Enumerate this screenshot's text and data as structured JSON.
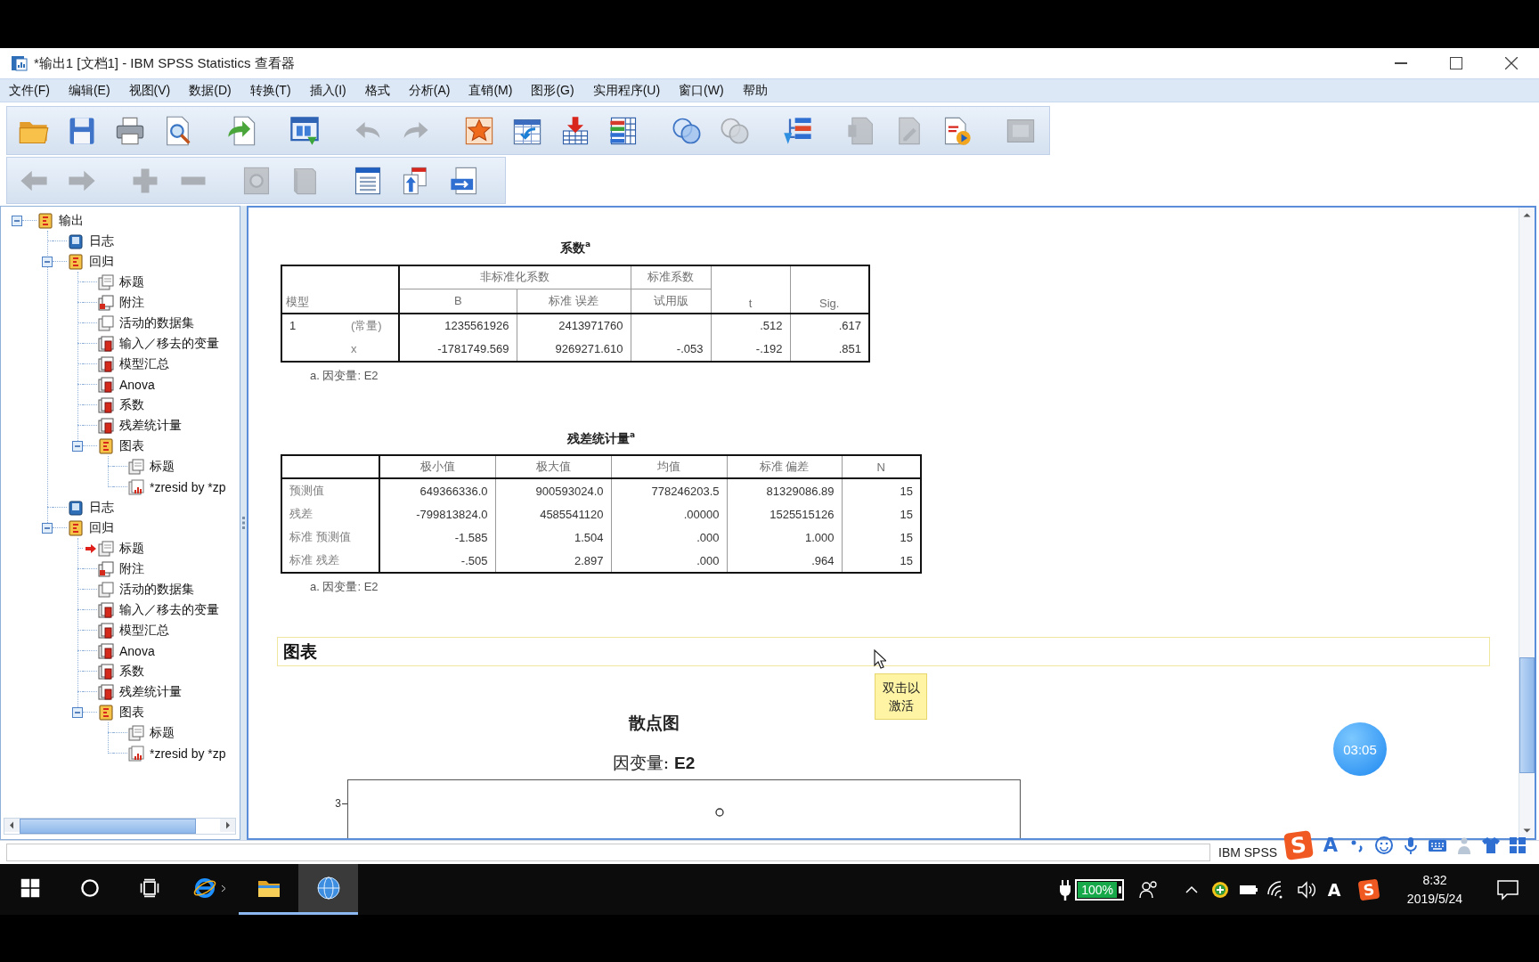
{
  "window": {
    "title": "*输出1 [文档1] - IBM SPSS Statistics 查看器"
  },
  "menu": [
    "文件(F)",
    "编辑(E)",
    "视图(V)",
    "数据(D)",
    "转换(T)",
    "插入(I)",
    "格式",
    "分析(A)",
    "直销(M)",
    "图形(G)",
    "实用程序(U)",
    "窗口(W)",
    "帮助"
  ],
  "toolbars": [
    {
      "groups": [
        [
          {
            "disabled": false
          },
          {
            "disabled": false
          },
          {
            "disabled": false
          },
          {
            "disabled": false
          }
        ],
        [
          {
            "disabled": false
          }
        ],
        [
          {
            "disabled": false
          }
        ],
        [
          {
            "disabled": true
          },
          {
            "disabled": true
          }
        ],
        [
          {
            "disabled": false
          },
          {
            "disabled": false
          },
          {
            "disabled": false
          },
          {
            "disabled": false
          }
        ],
        [
          {
            "disabled": false
          },
          {
            "disabled": true
          }
        ],
        [
          {
            "disabled": false
          }
        ],
        [
          {
            "disabled": true
          },
          {
            "disabled": true
          },
          {
            "disabled": false
          }
        ],
        [
          {
            "disabled": true
          }
        ]
      ]
    },
    {
      "groups": [
        [
          {
            "disabled": true
          },
          {
            "disabled": true
          }
        ],
        [
          {
            "disabled": true
          },
          {
            "disabled": true
          }
        ],
        [
          {
            "disabled": true
          },
          {
            "disabled": true
          }
        ],
        [
          {
            "disabled": false
          },
          {
            "disabled": false
          },
          {
            "disabled": false
          }
        ]
      ]
    }
  ],
  "outline": {
    "items": [
      {
        "label": "输出",
        "kind": "heading",
        "expanded": true,
        "selected": false,
        "children": [
          {
            "label": "日志",
            "kind": "log",
            "selected": false
          },
          {
            "label": "回归",
            "kind": "heading",
            "expanded": true,
            "selected": false,
            "children": [
              {
                "label": "标题",
                "kind": "title",
                "selected": false
              },
              {
                "label": "附注",
                "kind": "notes",
                "selected": false
              },
              {
                "label": "活动的数据集",
                "kind": "text",
                "selected": false
              },
              {
                "label": "输入／移去的变量",
                "kind": "table",
                "selected": false
              },
              {
                "label": "模型汇总",
                "kind": "table",
                "selected": false
              },
              {
                "label": "Anova",
                "kind": "table",
                "selected": false
              },
              {
                "label": "系数",
                "kind": "table",
                "selected": false
              },
              {
                "label": "残差统计量",
                "kind": "table",
                "selected": false
              },
              {
                "label": "图表",
                "kind": "heading",
                "expanded": true,
                "selected": false,
                "children": [
                  {
                    "label": "标题",
                    "kind": "title",
                    "selected": false
                  },
                  {
                    "label": "*zresid by *zp",
                    "kind": "chart",
                    "selected": false
                  }
                ]
              }
            ]
          },
          {
            "label": "日志",
            "kind": "log",
            "selected": false
          },
          {
            "label": "回归",
            "kind": "heading",
            "expanded": true,
            "selected": false,
            "children": [
              {
                "label": "标题",
                "kind": "title",
                "selected": true
              },
              {
                "label": "附注",
                "kind": "notes",
                "selected": false
              },
              {
                "label": "活动的数据集",
                "kind": "text",
                "selected": false
              },
              {
                "label": "输入／移去的变量",
                "kind": "table",
                "selected": false
              },
              {
                "label": "模型汇总",
                "kind": "table",
                "selected": false
              },
              {
                "label": "Anova",
                "kind": "table",
                "selected": false
              },
              {
                "label": "系数",
                "kind": "table",
                "selected": false
              },
              {
                "label": "残差统计量",
                "kind": "table",
                "selected": false
              },
              {
                "label": "图表",
                "kind": "heading",
                "expanded": true,
                "selected": false,
                "children": [
                  {
                    "label": "标题",
                    "kind": "title",
                    "selected": false
                  },
                  {
                    "label": "*zresid by *zp",
                    "kind": "chart",
                    "selected": false
                  }
                ]
              }
            ]
          }
        ]
      }
    ]
  },
  "output": {
    "tables": [
      {
        "kind": "coefficients",
        "title": "系数$^{a}$",
        "header_rows": [
          [
            {
              "text": "模型",
              "colspan": 2,
              "rowspan": 2
            },
            {
              "text": "非标准化系数",
              "colspan": 2
            },
            {
              "text": "标准系数"
            },
            {
              "text": "t",
              "rowspan": 2
            },
            {
              "text": "Sig.",
              "rowspan": 2
            }
          ],
          [
            {
              "text": "B"
            },
            {
              "text": "标准 误差"
            },
            {
              "text": "试用版"
            }
          ]
        ],
        "rows": [
          [
            "1",
            "(常量)",
            "1235561926",
            "2413971760",
            null,
            ".512",
            ".617"
          ],
          [
            null,
            "x",
            "-1781749.569",
            "9269271.610",
            "-.053",
            "-.192",
            ".851"
          ]
        ],
        "footnote": "a. 因变量: E2"
      },
      {
        "kind": "residuals",
        "title": "残差统计量$^{a}$",
        "columns": [
          "极小值",
          "极大值",
          "均值",
          "标准 偏差",
          "N"
        ],
        "rows": [
          {
            "label": "预测值",
            "cells": [
              "649366336.0",
              "900593024.0",
              "778246203.5",
              "81329086.89",
              "15"
            ]
          },
          {
            "label": "残差",
            "cells": [
              "-799813824.0",
              "4585541120",
              ".00000",
              "1525515126",
              "15"
            ]
          },
          {
            "label": "标准 预测值",
            "cells": [
              "-1.585",
              "1.504",
              ".000",
              "1.000",
              "15"
            ]
          },
          {
            "label": "标准 残差",
            "cells": [
              "-.505",
              "2.897",
              ".000",
              ".964",
              "15"
            ]
          }
        ],
        "footnote": "a. 因变量: E2"
      }
    ],
    "section_heading": "图表",
    "tooltip": "双击以激活",
    "chart": {
      "title": "散点图",
      "subtitle": "因变量: **E2**",
      "y_tick": "3"
    }
  },
  "recording_timer": "03:05",
  "status_bar": {
    "text": "IBM SPSS"
  },
  "ime_bar": {
    "logo": "S",
    "mode": "A"
  },
  "taskbar": {
    "apps": [
      {
        "open": false,
        "selected": false
      },
      {
        "open": true,
        "selected": false
      },
      {
        "open": true,
        "selected": true
      }
    ],
    "battery": "100%",
    "input_mode": "A",
    "ime_logo": "S",
    "time": "8:32",
    "date": "2019/5/24"
  }
}
